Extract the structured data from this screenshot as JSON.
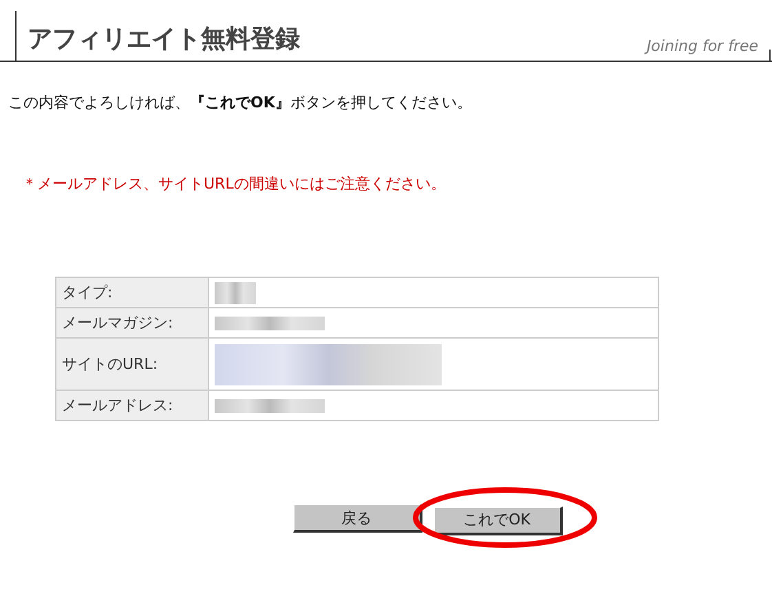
{
  "header": {
    "title": "アフィリエイト無料登録",
    "subtitle": "Joining for free"
  },
  "intro": "この内容でよろしければ、**『これでOK』**ボタンを押してください。",
  "notice": "＊メールアドレス、サイトURLの間違いにはご注意ください。",
  "table": {
    "rows": [
      {
        "label": "タイプ:",
        "kind": "short"
      },
      {
        "label": "メールマガジン:",
        "kind": "medium"
      },
      {
        "label": "サイトのURL:",
        "kind": "tall"
      },
      {
        "label": "メールアドレス:",
        "kind": "medium"
      }
    ]
  },
  "buttons": [
    {
      "label": "戻る",
      "highlighted": false
    },
    {
      "label": "これでOK",
      "highlighted": true
    }
  ]
}
